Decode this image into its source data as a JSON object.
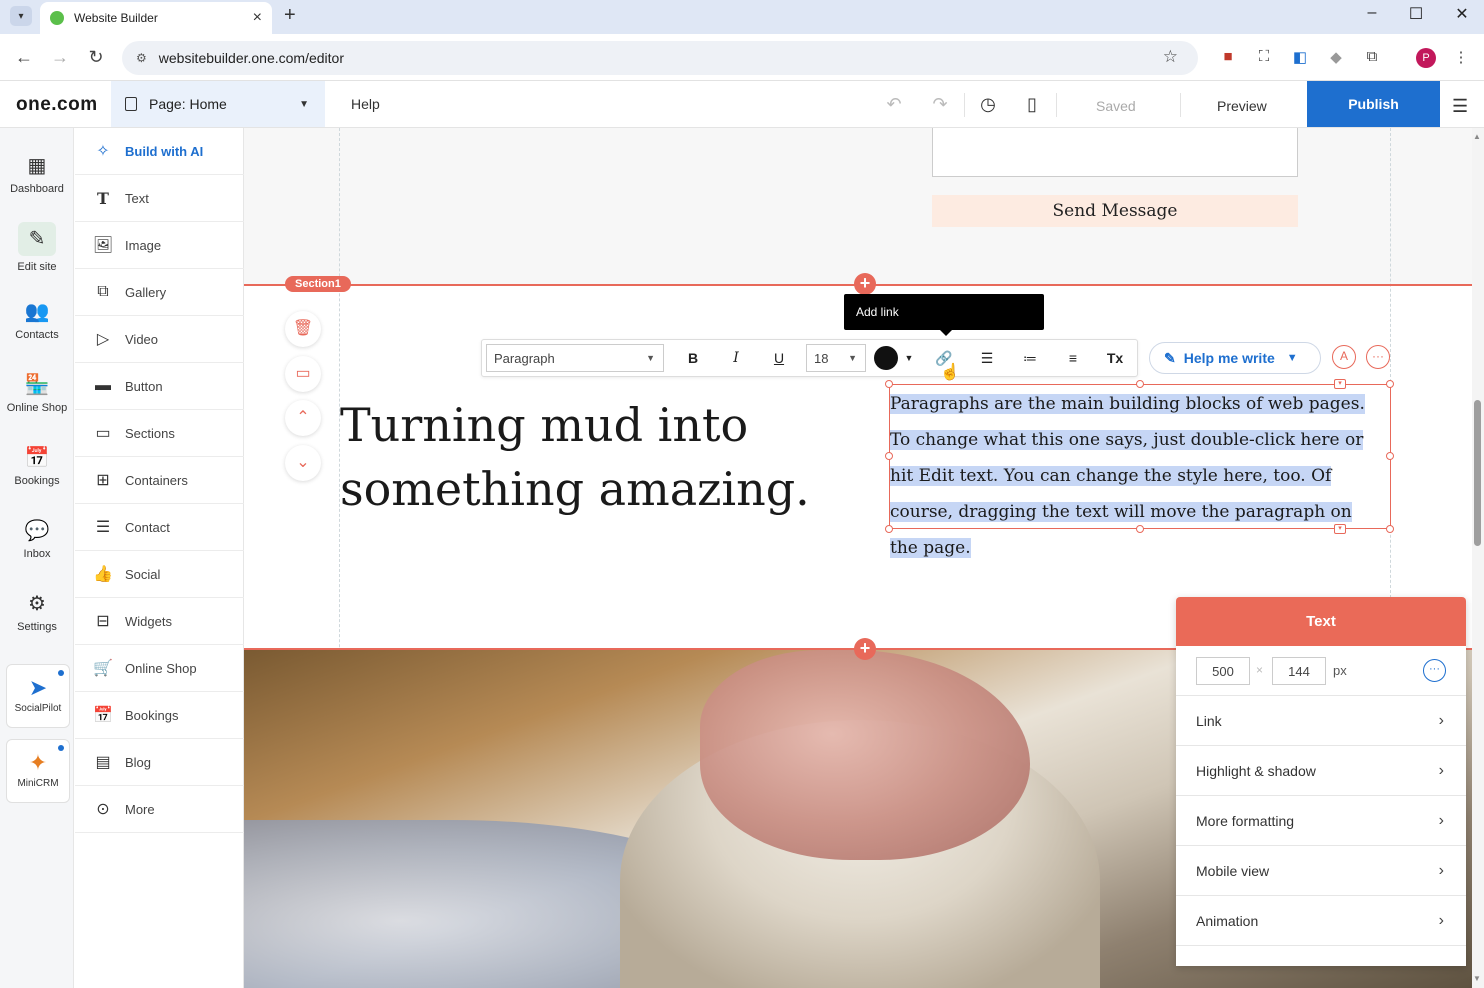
{
  "browser": {
    "tab_title": "Website Builder",
    "url": "websitebuilder.one.com/editor",
    "profile_initial": "P"
  },
  "header": {
    "logo": "one.com",
    "page_label": "Page: Home",
    "help": "Help",
    "saved": "Saved",
    "preview": "Preview",
    "publish": "Publish"
  },
  "rail": [
    {
      "label": "Dashboard"
    },
    {
      "label": "Edit site"
    },
    {
      "label": "Contacts"
    },
    {
      "label": "Online Shop"
    },
    {
      "label": "Bookings"
    },
    {
      "label": "Inbox"
    },
    {
      "label": "Settings"
    },
    {
      "label": "SocialPilot"
    },
    {
      "label": "MiniCRM"
    }
  ],
  "panel": [
    {
      "label": "Build with AI"
    },
    {
      "label": "Text"
    },
    {
      "label": "Image"
    },
    {
      "label": "Gallery"
    },
    {
      "label": "Video"
    },
    {
      "label": "Button"
    },
    {
      "label": "Sections"
    },
    {
      "label": "Containers"
    },
    {
      "label": "Contact"
    },
    {
      "label": "Social"
    },
    {
      "label": "Widgets"
    },
    {
      "label": "Online Shop"
    },
    {
      "label": "Bookings"
    },
    {
      "label": "Blog"
    },
    {
      "label": "More"
    }
  ],
  "canvas": {
    "send_message": "Send Message",
    "section_badge": "Section1",
    "tooltip": "Add link",
    "heading": "Turning mud into something amazing.",
    "paragraph": "Paragraphs are the main building blocks of web pages. To change what this one says, just double-click here or hit Edit text. You can change the style here, too. Of course, dragging the text will move the paragraph on the page."
  },
  "toolbar": {
    "style_select": "Paragraph",
    "font_size": "18",
    "bold": "B",
    "italic": "I",
    "underline": "U",
    "clear": "Tx",
    "help_me_write": "Help me write"
  },
  "text_panel": {
    "title": "Text",
    "width": "500",
    "height": "144",
    "unit": "px",
    "rows": [
      {
        "label": "Link"
      },
      {
        "label": "Highlight & shadow"
      },
      {
        "label": "More formatting"
      },
      {
        "label": "Mobile view"
      },
      {
        "label": "Animation"
      }
    ]
  },
  "colors": {
    "accent": "#e8695a",
    "brand_blue": "#1e6fcf"
  }
}
